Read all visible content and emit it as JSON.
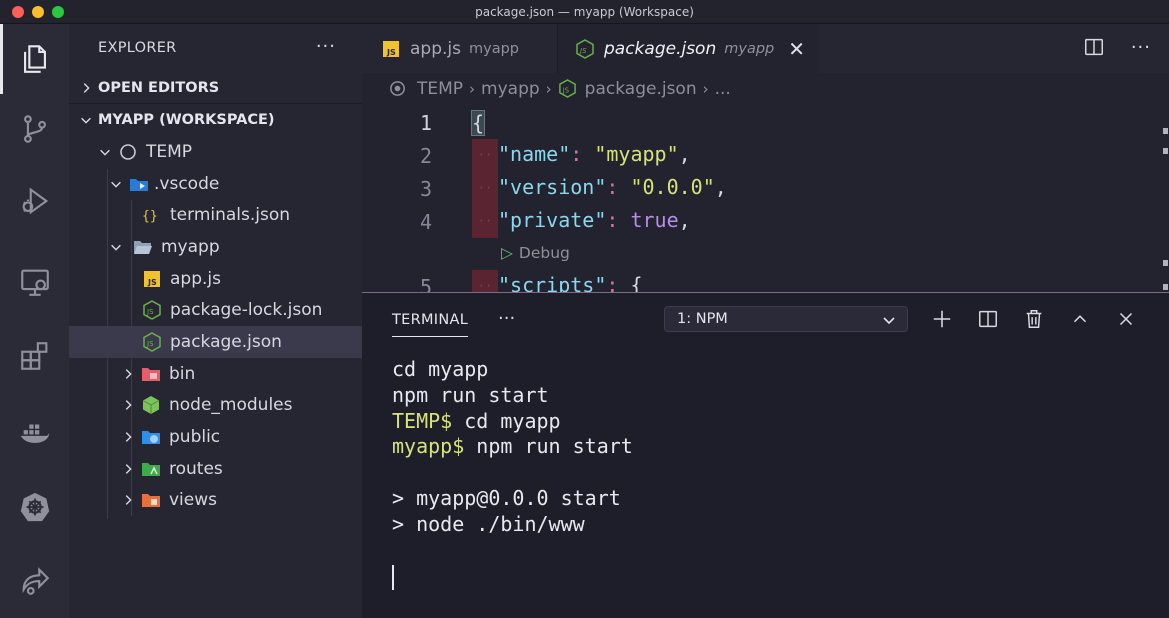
{
  "window": {
    "title": "package.json — myapp (Workspace)"
  },
  "activity_bar": {
    "icons": [
      "files-icon",
      "source-control-icon",
      "run-debug-icon",
      "remote-explorer-icon",
      "extensions-icon",
      "docker-icon",
      "kubernetes-icon",
      "live-share-icon"
    ]
  },
  "explorer": {
    "title": "EXPLORER",
    "more": "···",
    "open_editors": "OPEN EDITORS",
    "workspace": "MYAPP (WORKSPACE)",
    "tree": [
      {
        "label": "TEMP",
        "icon": "circle-icon"
      },
      {
        "label": ".vscode",
        "icon": "vscode-folder-icon"
      },
      {
        "label": "terminals.json",
        "icon": "json-file-icon"
      },
      {
        "label": "myapp",
        "icon": "folder-open-icon"
      },
      {
        "label": "app.js",
        "icon": "js-file-icon"
      },
      {
        "label": "package-lock.json",
        "icon": "nodejs-file-icon"
      },
      {
        "label": "package.json",
        "icon": "nodejs-file-icon"
      },
      {
        "label": "bin",
        "icon": "bin-folder-icon"
      },
      {
        "label": "node_modules",
        "icon": "node-modules-folder-icon"
      },
      {
        "label": "public",
        "icon": "public-folder-icon"
      },
      {
        "label": "routes",
        "icon": "routes-folder-icon"
      },
      {
        "label": "views",
        "icon": "views-folder-icon"
      }
    ]
  },
  "tabs": [
    {
      "label": "app.js",
      "sub": "myapp"
    },
    {
      "label": "package.json",
      "sub": "myapp",
      "close": "✕"
    }
  ],
  "breadcrumbs": [
    "TEMP",
    "myapp",
    "package.json",
    "..."
  ],
  "code": {
    "line_numbers": [
      "1",
      "2",
      "3",
      "4",
      "5"
    ],
    "brace_open": "{",
    "name_key": "\"name\"",
    "name_val": "\"myapp\"",
    "version_key": "\"version\"",
    "version_val": "\"0.0.0\"",
    "private_key": "\"private\"",
    "private_val": "true",
    "codelens": "Debug",
    "scripts_key": "\"scripts\"",
    "colon": ":",
    "comma": ",",
    "scripts_brace": "{"
  },
  "panel": {
    "tab": "TERMINAL",
    "more": "···",
    "select_value": "1: NPM",
    "terminal": {
      "line1": "cd myapp",
      "line2": "npm run start",
      "prompt1": "TEMP$",
      "cmd1": " cd myapp",
      "prompt2": "myapp$",
      "cmd2": " npm run start",
      "out1": "> myapp@0.0.0 start",
      "out2": "> node ./bin/www"
    }
  }
}
